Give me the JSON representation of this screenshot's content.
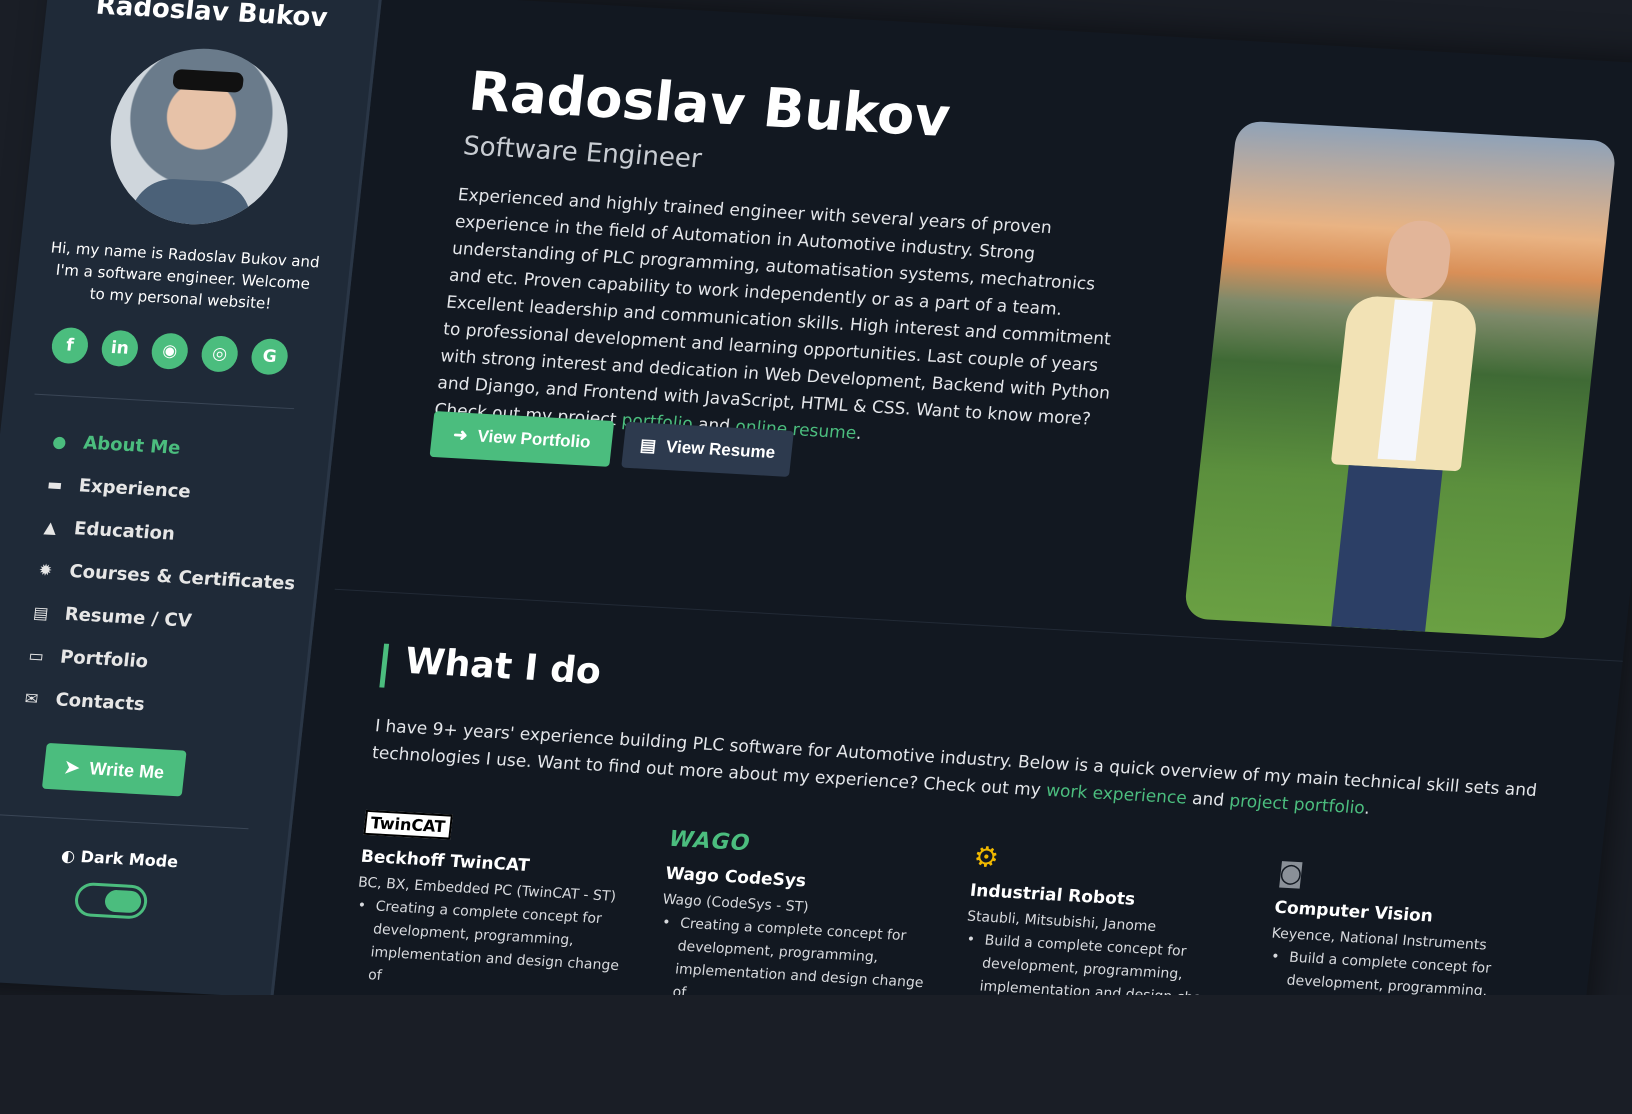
{
  "colors": {
    "accent": "#4bbd7e",
    "sidebar_bg": "#1f2a38",
    "main_bg": "#121821",
    "secondary_button": "#2d3a4e"
  },
  "sidebar": {
    "name": "Radoslav Bukov",
    "intro": "Hi, my name is Radoslav Bukov and I'm a software engineer. Welcome to my personal website!",
    "socials": [
      {
        "icon": "facebook-icon",
        "glyph": "f"
      },
      {
        "icon": "linkedin-icon",
        "glyph": "in"
      },
      {
        "icon": "github-icon",
        "glyph": "◉"
      },
      {
        "icon": "instagram-icon",
        "glyph": "◎"
      },
      {
        "icon": "google-icon",
        "glyph": "G"
      }
    ],
    "nav": [
      {
        "label": "About Me",
        "icon": "user-icon",
        "glyph": "●",
        "active": true
      },
      {
        "label": "Experience",
        "icon": "briefcase-icon",
        "glyph": "▬"
      },
      {
        "label": "Education",
        "icon": "graduation-cap-icon",
        "glyph": "▲"
      },
      {
        "label": "Courses & Certificates",
        "icon": "certificate-icon",
        "glyph": "✹"
      },
      {
        "label": "Resume / CV",
        "icon": "file-icon",
        "glyph": "▤"
      },
      {
        "label": "Portfolio",
        "icon": "laptop-icon",
        "glyph": "▭"
      },
      {
        "label": "Contacts",
        "icon": "envelope-open-icon",
        "glyph": "✉"
      }
    ],
    "write_me": "Write Me",
    "dark_mode_label": "Dark Mode",
    "dark_mode_on": true
  },
  "hero": {
    "name": "Radoslav Bukov",
    "role": "Software Engineer",
    "text_pre": "Experienced and highly trained engineer with several years of proven experience in the field of Automation in Automotive industry. Strong understanding of PLC programming, automatisation systems, mechatronics and etc. Proven capability to work independently or as a part of a team. Excellent leadership and communication skills. High interest and commitment to professional development and learning opportunities. Last couple of years with strong interest and dedication in Web Development, Backend with Python and Django, and Frontend with JavaScript, HTML & CSS. Want to know more? Check out my project ",
    "link_portfolio": "portfolio",
    "text_and": " and ",
    "link_resume": "online resume",
    "text_end": ".",
    "btn_portfolio": "View Portfolio",
    "btn_resume": "View Resume"
  },
  "what_i_do": {
    "title": "What I do",
    "text_pre": "I have 9+ years' experience building PLC software for Automotive industry. Below is a quick overview of my main technical skill sets and technologies I use. Want to find out more about my experience? Check out my ",
    "link_experience": "work experience",
    "text_and": " and ",
    "link_portfolio": "project portfolio",
    "text_end": ".",
    "skills": [
      {
        "logo": "TwinCAT",
        "name": "Beckhoff TwinCAT",
        "sub": "BC, BX, Embedded PC (TwinCAT - ST)",
        "bullet": "Creating a complete concept for development, programming, implementation and design change of"
      },
      {
        "logo": "WAGO",
        "name": "Wago CodeSys",
        "sub": "Wago (CodeSys - ST)",
        "bullet": "Creating a complete concept for development, programming, implementation and design change of"
      },
      {
        "logo": "robot-arm-icon",
        "name": "Industrial Robots",
        "sub": "Staubli, Mitsubishi, Janome",
        "bullet": "Build a complete concept for development, programming, implementation and design change of"
      },
      {
        "logo": "camera-icon",
        "name": "Computer Vision",
        "sub": "Keyence, National Instruments",
        "bullet": "Build a complete concept for development, programming, implementation and design change of"
      }
    ]
  }
}
